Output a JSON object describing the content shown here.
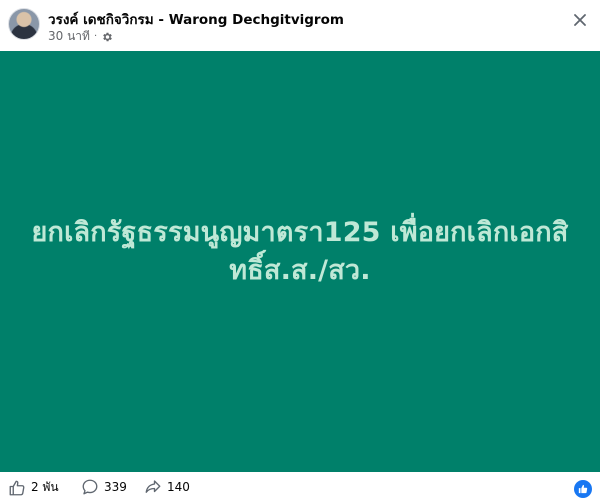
{
  "post": {
    "author_name": "วรงค์ เดชกิจวิกรม - Warong Dechgitvigrom",
    "time_ago": "30 นาที",
    "separator": "·",
    "text": "ยกเลิกรัฐธรรมนูญมาตรา125 เพื่อยกเลิกเอกสิทธิ์ส.ส./สว.",
    "background_color": "#00806a",
    "text_color": "#bfe8d6"
  },
  "icons": {
    "audience": "gear-icon",
    "close": "close-icon",
    "like": "thumbs-up-icon",
    "comment": "comment-bubble-icon",
    "share": "share-arrow-icon",
    "reaction": "like-reaction-icon"
  },
  "stats": {
    "likes": "2 พัน",
    "comments": "339",
    "shares": "140"
  },
  "colors": {
    "accent": "#1877f2",
    "muted": "#65676b"
  }
}
